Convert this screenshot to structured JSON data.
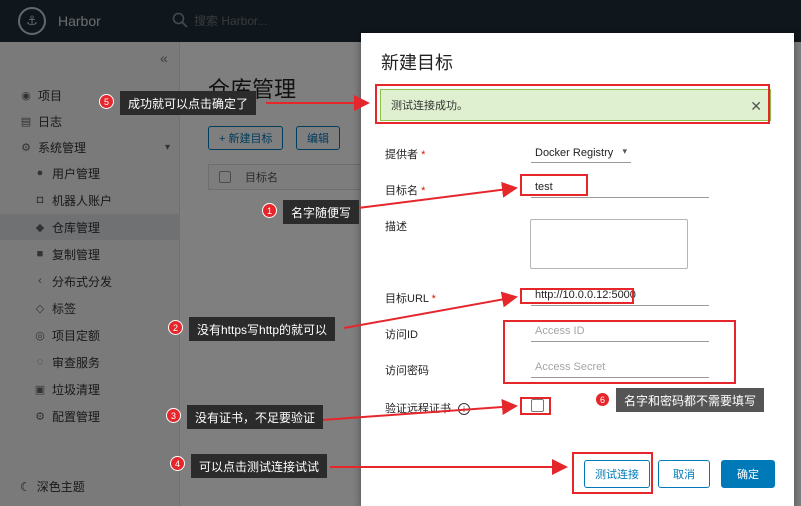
{
  "app": {
    "brand": "Harbor",
    "search_placeholder": "搜索 Harbor..."
  },
  "sidebar": {
    "items": [
      {
        "label": "项目",
        "icon": "projects-icon"
      },
      {
        "label": "日志",
        "icon": "logs-icon"
      },
      {
        "label": "系统管理",
        "icon": "admin-icon"
      }
    ],
    "subitems": [
      {
        "label": "用户管理",
        "icon": "users-icon"
      },
      {
        "label": "机器人账户",
        "icon": "robot-icon"
      },
      {
        "label": "仓库管理",
        "icon": "registry-icon"
      },
      {
        "label": "复制管理",
        "icon": "replication-icon"
      },
      {
        "label": "分布式分发",
        "icon": "distribution-icon"
      },
      {
        "label": "标签",
        "icon": "tag-icon"
      },
      {
        "label": "项目定额",
        "icon": "quota-icon"
      },
      {
        "label": "审查服务",
        "icon": "interrogation-icon"
      },
      {
        "label": "垃圾清理",
        "icon": "gc-icon"
      },
      {
        "label": "配置管理",
        "icon": "config-icon"
      }
    ],
    "theme_label": "深色主题"
  },
  "main": {
    "title": "仓库管理",
    "new_button": "+ 新建目标",
    "edit_button": "编辑",
    "column_name": "目标名"
  },
  "modal": {
    "title": "新建目标",
    "alert": "测试连接成功。",
    "provider_label": "提供者",
    "provider_value": "Docker Registry",
    "name_label": "目标名",
    "name_value": "test",
    "desc_label": "描述",
    "url_label": "目标URL",
    "url_value": "http://10.0.0.12:5000",
    "access_id_label": "访问ID",
    "access_id_placeholder": "Access ID",
    "access_secret_label": "访问密码",
    "access_secret_placeholder": "Access Secret",
    "verify_label": "验证远程证书",
    "test_button": "测试连接",
    "cancel_button": "取消",
    "ok_button": "确定",
    "required_mark": "*"
  },
  "annotations": [
    {
      "num": "1",
      "text": "名字随便写"
    },
    {
      "num": "2",
      "text": "没有https写http的就可以"
    },
    {
      "num": "3",
      "text": "没有证书，不足要验证"
    },
    {
      "num": "4",
      "text": "可以点击测试连接试试"
    },
    {
      "num": "5",
      "text": "成功就可以点击确定了"
    },
    {
      "num": "6",
      "text": "名字和密码都不需要填写"
    }
  ],
  "colors": {
    "annotation_red": "#e5272c",
    "primary": "#0079b8",
    "success_bg": "#dff0d0"
  }
}
